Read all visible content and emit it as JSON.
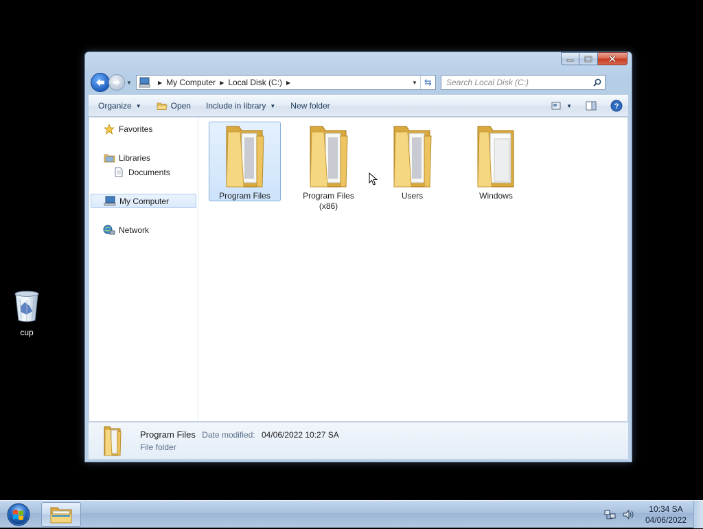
{
  "desktop": {
    "icons": [
      {
        "label": "cup",
        "icon": "recycle-bin-icon"
      }
    ]
  },
  "window": {
    "address": {
      "crumbs": [
        "My Computer",
        "Local Disk (C:)"
      ]
    },
    "search": {
      "placeholder": "Search Local Disk (C:)"
    },
    "commands": {
      "organize": "Organize",
      "open": "Open",
      "include_in_library": "Include in library",
      "new_folder": "New folder"
    },
    "nav": {
      "favorites": "Favorites",
      "libraries": "Libraries",
      "documents": "Documents",
      "my_computer": "My Computer",
      "network": "Network"
    },
    "folders": [
      {
        "label": "Program Files",
        "selected": true
      },
      {
        "label": "Program Files (x86)",
        "selected": false
      },
      {
        "label": "Users",
        "selected": false
      },
      {
        "label": "Windows",
        "selected": false
      }
    ],
    "details": {
      "name": "Program Files",
      "date_label": "Date modified:",
      "date_value": "04/06/2022 10:27 SA",
      "type": "File folder"
    }
  },
  "taskbar": {
    "time": "10:34 SA",
    "date": "04/06/2022"
  },
  "colors": {
    "accent": "#1f5fbf",
    "selection": "#cde3fb",
    "folder": "#f0c75e"
  }
}
